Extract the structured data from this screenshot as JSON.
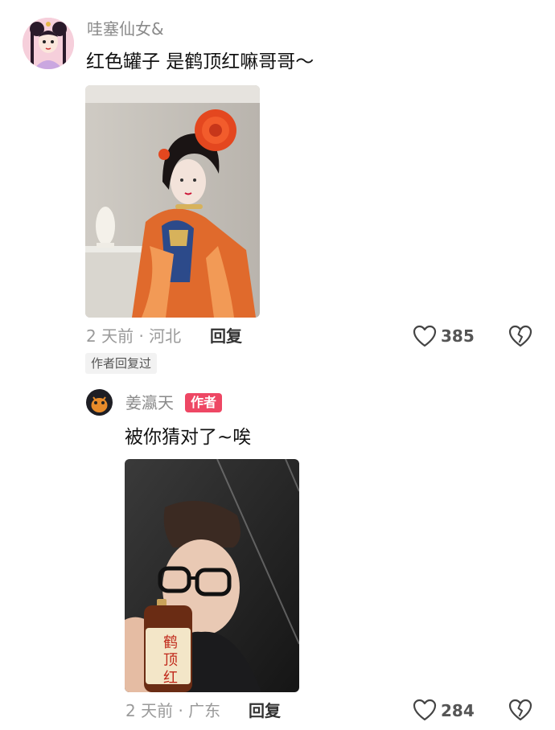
{
  "comment1": {
    "username": "哇塞仙女&",
    "text": "红色罐子 是鹤顶红嘛哥哥～",
    "time_location": "2 天前 · 河北",
    "reply_label": "回复",
    "likes": "385",
    "author_replied": "作者回复过"
  },
  "reply1": {
    "username": "姜瀛天",
    "badge": "作者",
    "text": "被你猜对了~唉",
    "bottle_label_line1": "鹤",
    "bottle_label_line2": "顶",
    "bottle_label_line3": "红",
    "time_location": "2 天前 · 广东",
    "reply_label": "回复",
    "likes": "284"
  },
  "colors": {
    "author_badge": "#ee4764",
    "accent_dress": "#e06a2c"
  },
  "icons": {
    "like": "heart-outline-icon",
    "dislike": "broken-heart-icon"
  }
}
